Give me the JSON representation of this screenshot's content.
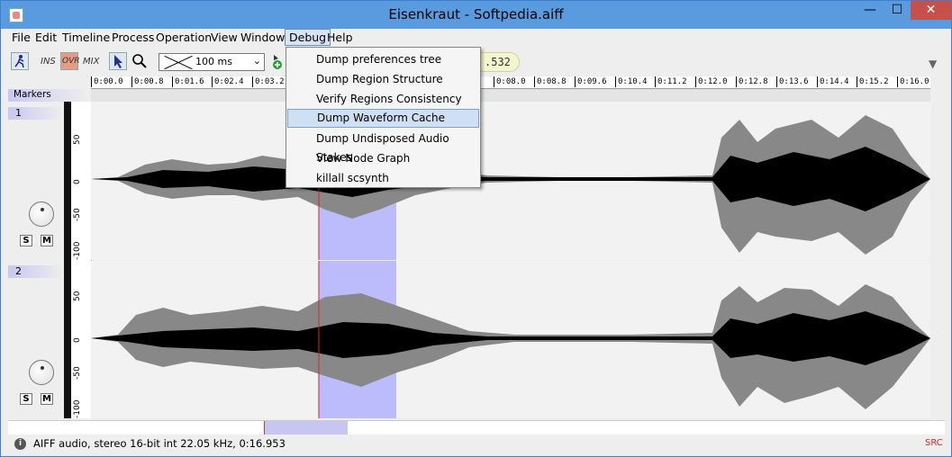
{
  "window": {
    "title": "Eisenkraut - Softpedia.aiff",
    "min_glyph": "—",
    "max_glyph": "☐",
    "close_glyph": "✕"
  },
  "menubar": {
    "items": [
      "File",
      "Edit",
      "Timeline",
      "Process",
      "Operation",
      "View",
      "Window",
      "Debug",
      "Help"
    ],
    "active": "Debug"
  },
  "toolbar": {
    "ins_label": "INS",
    "ovr_label": "OVR",
    "mix_label": "MIX",
    "zoom_value": "100 ms",
    "combo_arrow": "⌄",
    "timecode": ".532",
    "more_glyph": "▼"
  },
  "debug_menu": {
    "items": [
      "Dump preferences tree",
      "Dump Region Structure",
      "Verify Regions Consistency",
      "Dump Waveform Cache",
      "Dump Undisposed Audio Stakes",
      "View Node Graph",
      "killall scsynth"
    ],
    "highlighted": "Dump Waveform Cache"
  },
  "ruler": {
    "ticks": [
      "0:00.0",
      "0:00.8",
      "0:01.6",
      "0:02.4",
      "0:03.2",
      "0:08.0",
      "0:08.8",
      "0:09.6",
      "0:10.4",
      "0:11.2",
      "0:12.0",
      "0:12.8",
      "0:13.6",
      "0:14.4",
      "0:15.2",
      "0:16.0"
    ]
  },
  "markers": {
    "label": "Markers"
  },
  "tracks": [
    {
      "number": "1",
      "solo": "S",
      "mute": "M",
      "scale": [
        "50",
        "0",
        "-50",
        "-100"
      ]
    },
    {
      "number": "2",
      "solo": "S",
      "mute": "M",
      "scale": [
        "50",
        "0",
        "-50",
        "-100"
      ]
    }
  ],
  "status": {
    "info_glyph": "i",
    "text": "AIFF audio, stereo 16-bit int 22.05 kHz, 0:16.953",
    "right": "SRC"
  },
  "colors": {
    "titlebar": "#5a9be0",
    "selection": "#aaaaff",
    "waveform_outer": "#888888",
    "waveform_inner": "#000000",
    "playhead": "#dd2222"
  }
}
